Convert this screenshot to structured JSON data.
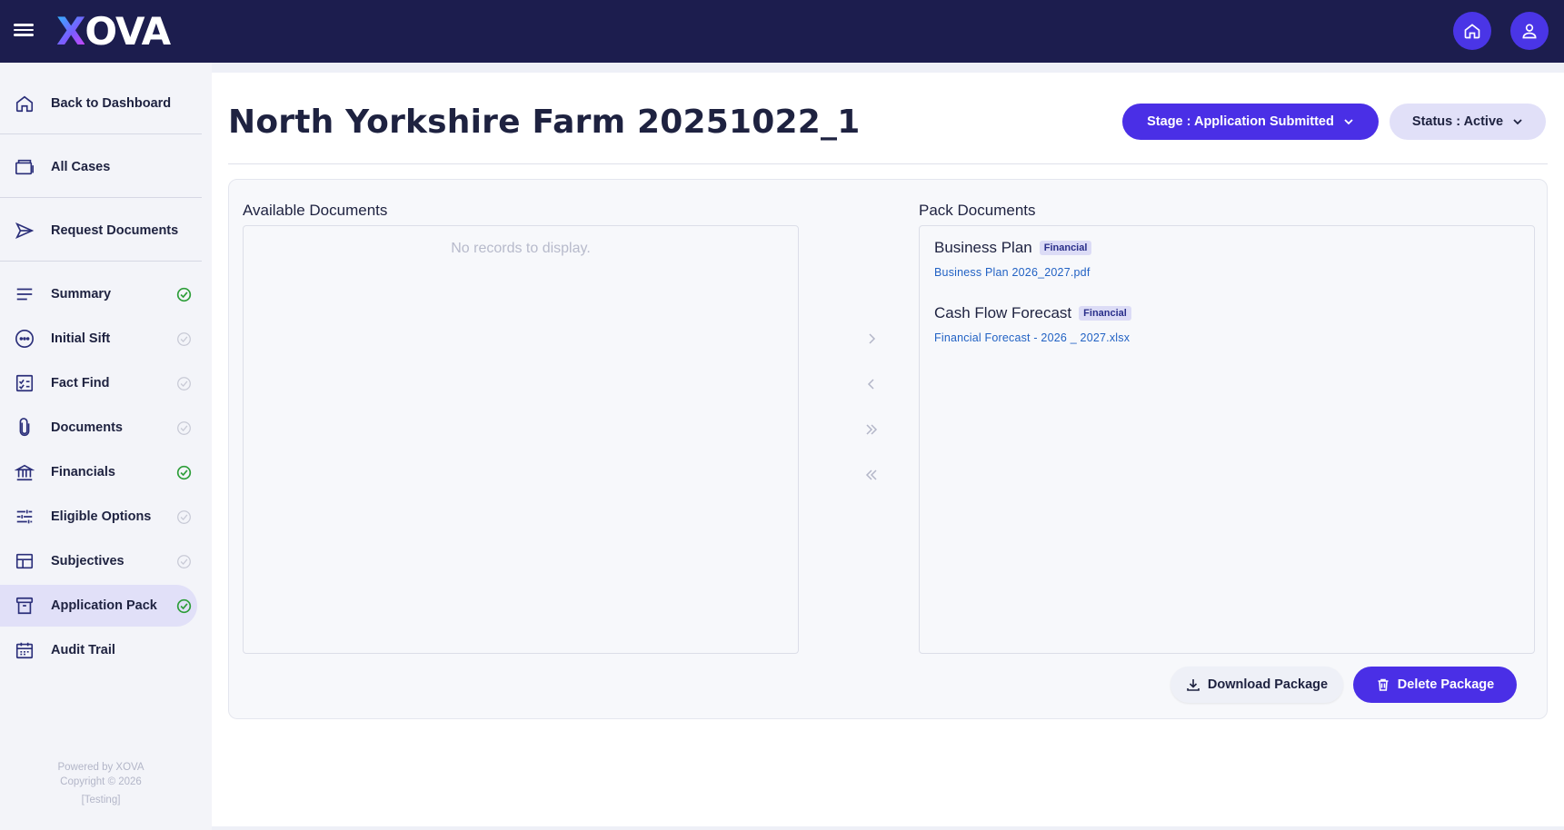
{
  "header": {
    "logo_text_x": "X",
    "logo_text_rest": "OVA",
    "menu_icon": "hamburger-icon",
    "home_icon": "home-icon",
    "user_icon": "user-icon"
  },
  "sidebar": {
    "items": [
      {
        "label": "Back to Dashboard",
        "icon": "home-outline-icon",
        "status": "none"
      },
      {
        "label": "All Cases",
        "icon": "briefcase-icon",
        "status": "none"
      },
      {
        "label": "Request Documents",
        "icon": "send-icon",
        "status": "none"
      },
      {
        "label": "Summary",
        "icon": "list-icon",
        "status": "complete"
      },
      {
        "label": "Initial Sift",
        "icon": "dots-circle-icon",
        "status": "pending"
      },
      {
        "label": "Fact Find",
        "icon": "checklist-icon",
        "status": "pending"
      },
      {
        "label": "Documents",
        "icon": "paperclip-icon",
        "status": "pending"
      },
      {
        "label": "Financials",
        "icon": "bank-icon",
        "status": "complete"
      },
      {
        "label": "Eligible Options",
        "icon": "sliders-icon",
        "status": "pending"
      },
      {
        "label": "Subjectives",
        "icon": "layout-icon",
        "status": "pending"
      },
      {
        "label": "Application Pack",
        "icon": "archive-icon",
        "status": "complete"
      },
      {
        "label": "Audit Trail",
        "icon": "calendar-icon",
        "status": "none"
      }
    ],
    "footer": {
      "powered": "Powered by XOVA",
      "copyright": "Copyright © 2026",
      "env": "[Testing]"
    }
  },
  "main": {
    "title": "North Yorkshire Farm 20251022_1",
    "stage_label": "Stage : Application Submitted",
    "status_label": "Status : Active",
    "available": {
      "title": "Available Documents",
      "empty_text": "No records to display."
    },
    "pack": {
      "title": "Pack Documents",
      "documents": [
        {
          "name": "Business Plan",
          "tag": "Financial",
          "file": "Business Plan 2026_2027.pdf"
        },
        {
          "name": "Cash Flow Forecast",
          "tag": "Financial",
          "file": "Financial Forecast - 2026 _ 2027.xlsx"
        }
      ]
    },
    "transfer": {
      "move_right": "chevron-right-icon",
      "move_left": "chevron-left-icon",
      "move_all_right": "double-chevron-right-icon",
      "move_all_left": "double-chevron-left-icon"
    },
    "download_label": "Download Package",
    "delete_label": "Delete Package"
  },
  "colors": {
    "topbar": "#1c1d4e",
    "accent": "#4a2fe6",
    "active_bg": "#e1e0f8",
    "success": "#2e9e3a",
    "pending": "#c8cad6",
    "link": "#2262c4"
  }
}
